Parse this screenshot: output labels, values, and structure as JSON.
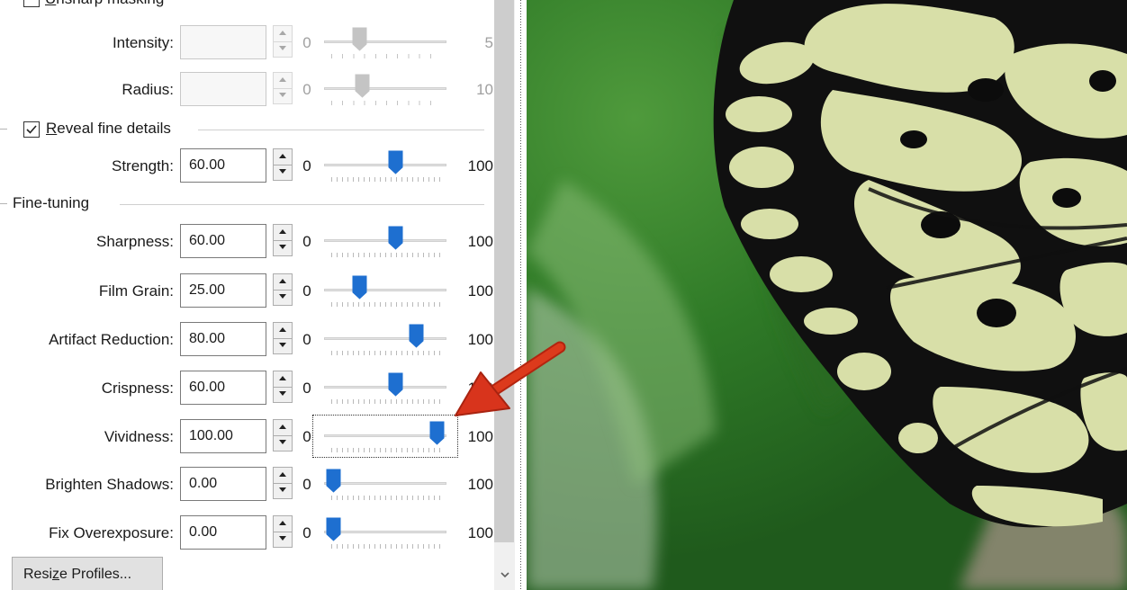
{
  "groups": {
    "unsharp": {
      "label_prefix": "",
      "label_mnemonic": "U",
      "label_rest": "nsharp masking",
      "checked": false
    },
    "reveal": {
      "label_prefix": "",
      "label_mnemonic": "R",
      "label_rest": "eveal fine details",
      "checked": true
    },
    "finetuning": {
      "label": "Fine-tuning"
    }
  },
  "rows": {
    "intensity": {
      "label": "Intensity:",
      "value": "",
      "min": "0",
      "max": "5",
      "level": 0.25,
      "enabled": false
    },
    "radius": {
      "label": "Radius:",
      "value": "",
      "min": "0",
      "max": "10",
      "level": 0.28,
      "enabled": false
    },
    "strength": {
      "label": "Strength:",
      "value": "60.00",
      "min": "0",
      "max": "100",
      "level": 0.6,
      "enabled": true
    },
    "sharpness": {
      "label": "Sharpness:",
      "value": "60.00",
      "min": "0",
      "max": "100",
      "level": 0.6,
      "enabled": true
    },
    "film_grain": {
      "label": "Film Grain:",
      "value": "25.00",
      "min": "0",
      "max": "100",
      "level": 0.25,
      "enabled": true
    },
    "artifact_reduction": {
      "label": "Artifact Reduction:",
      "value": "80.00",
      "min": "0",
      "max": "100",
      "level": 0.8,
      "enabled": true
    },
    "crispness": {
      "label": "Crispness:",
      "value": "60.00",
      "min": "0",
      "max": "100",
      "level": 0.6,
      "enabled": true
    },
    "vividness": {
      "label": "Vividness:",
      "value": "100.00",
      "min": "0",
      "max": "100",
      "level": 1.0,
      "enabled": true
    },
    "brighten_shadows": {
      "label": "Brighten Shadows:",
      "value": "0.00",
      "min": "0",
      "max": "100",
      "level": 0.0,
      "enabled": true
    },
    "fix_overexposure": {
      "label": "Fix Overexposure:",
      "value": "0.00",
      "min": "0",
      "max": "100",
      "level": 0.0,
      "enabled": true
    }
  },
  "buttons": {
    "resize_prefix": "Resi",
    "resize_mnemonic": "z",
    "resize_rest": "e Profiles..."
  },
  "colors": {
    "accent": "#1e6fd0",
    "annotation_arrow": "#d8341c",
    "disabled_thumb": "#c4c4c4"
  },
  "icons": {
    "scroll_down": "chevron-down-icon",
    "checkbox": "checkmark-icon",
    "annotation": "red-arrow-icon"
  }
}
